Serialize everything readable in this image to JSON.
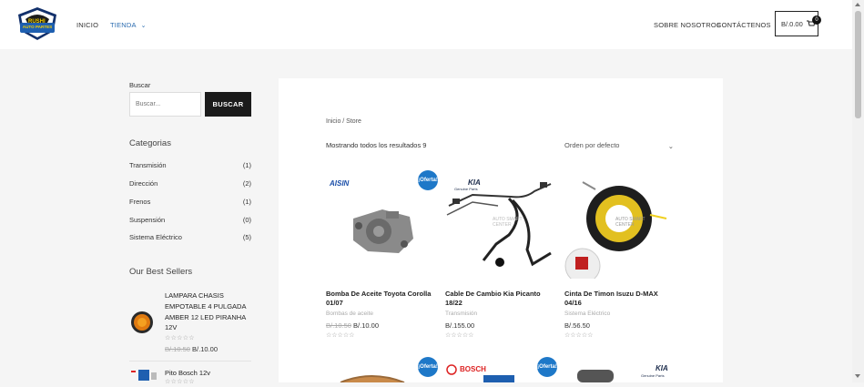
{
  "header": {
    "logo_text_top": "RUSHI",
    "logo_text_bottom": "AUTO PARTES",
    "nav": [
      {
        "label": "INICIO"
      },
      {
        "label": "TIENDA"
      },
      {
        "label": "SOBRE NOSOTROS"
      },
      {
        "label": "CONTÁCTENOS"
      }
    ],
    "cart_amount": "B/.0.00",
    "cart_count": "0"
  },
  "sidebar": {
    "search_label": "Buscar",
    "search_placeholder": "Buscar...",
    "search_button": "BUSCAR",
    "categories_title": "Categorias",
    "categories": [
      {
        "name": "Transmisión",
        "count": "(1)"
      },
      {
        "name": "Dirección",
        "count": "(2)"
      },
      {
        "name": "Frenos",
        "count": "(1)"
      },
      {
        "name": "Suspensión",
        "count": "(0)"
      },
      {
        "name": "Sistema Eléctrico",
        "count": "(5)"
      }
    ],
    "bestsellers_title": "Our Best Sellers",
    "bestsellers": [
      {
        "title": "LAMPARA CHASIS EMPOTABLE 4 PULGADA AMBER 12 LED PIRANHA 12V",
        "stars": "☆☆☆☆☆",
        "old_price": "B/.10.50",
        "price": "B/.10.00"
      },
      {
        "title": "Pito Bosch 12v",
        "stars": "☆☆☆☆☆"
      }
    ]
  },
  "main": {
    "breadcrumb": "Inicio / Store",
    "results": "Mostrando todos los resultados 9",
    "orderby": "Orden por defecto",
    "products": [
      {
        "title": "Bomba De Aceite Toyota Corolla 01/07",
        "category": "Bombas de aceite",
        "old_price": "B/.10.50",
        "price": "B/.10.00",
        "badge": "¡Oferta!",
        "brand": "AISIN",
        "stars": "☆☆☆☆☆"
      },
      {
        "title": "Cable De Cambio Kia Picanto 18/22",
        "category": "Transmisión",
        "price": "B/.155.00",
        "brand": "KIA",
        "brand_sub": "Genuine Parts",
        "watermark": "AUTO SMART CENTER",
        "stars": "☆☆☆☆☆"
      },
      {
        "title": "Cinta De Timon Isuzu D-MAX 04/16",
        "category": "Sistema Eléctrico",
        "price": "B/.56.50",
        "watermark": "AUTO SMART CENTER",
        "stars": "☆☆☆☆☆"
      }
    ],
    "row2": [
      {
        "badge": "¡Oferta!"
      },
      {
        "badge": "¡Oferta!",
        "brand": "BOSCH"
      },
      {
        "brand": "KIA",
        "brand_sub": "Genuine Parts"
      }
    ]
  },
  "colors": {
    "accent": "#1e78c8",
    "button": "#1b1b1b",
    "nav_active": "#2b6cb0"
  }
}
